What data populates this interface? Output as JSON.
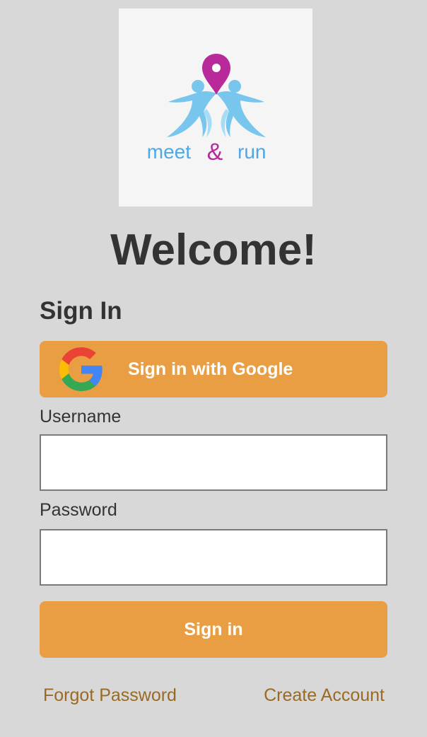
{
  "logo": {
    "wordmark_left": "meet",
    "wordmark_amp": "&",
    "wordmark_right": "run",
    "icon": "map-pin-runners-logo",
    "colors": {
      "pin": "#b8299a",
      "runners": "#78c5ee",
      "runners_light": "#a6dcf5",
      "wordmark": "#4fa8e6",
      "amp": "#b8299a"
    }
  },
  "header": {
    "title": "Welcome!"
  },
  "form": {
    "heading": "Sign In",
    "google_button_label": "Sign in with Google",
    "google_icon": "google-g-icon",
    "username_label": "Username",
    "username_value": "",
    "username_placeholder": "",
    "password_label": "Password",
    "password_value": "",
    "password_placeholder": "",
    "submit_label": "Sign in"
  },
  "links": {
    "forgot_password": "Forgot Password",
    "create_account": "Create Account"
  },
  "colors": {
    "background": "#d8d8d8",
    "accent": "#ea9e43",
    "link": "#9a6a24",
    "text": "#333333"
  }
}
